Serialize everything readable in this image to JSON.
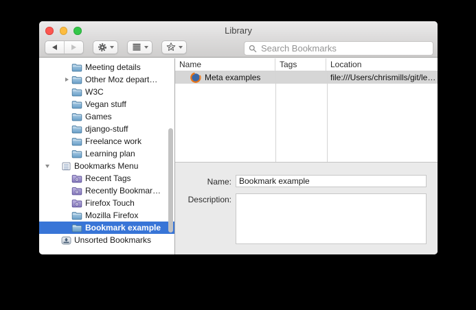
{
  "window": {
    "title": "Library"
  },
  "toolbar": {
    "search_placeholder": "Search Bookmarks",
    "buttons": [
      {
        "icon": "back-arrow-icon",
        "enabled": true
      },
      {
        "icon": "forward-arrow-icon",
        "enabled": false
      },
      {
        "icon": "gear-icon",
        "has_dropdown": true
      },
      {
        "icon": "list-view-icon",
        "has_dropdown": true
      },
      {
        "icon": "star-sync-icon",
        "has_dropdown": true
      }
    ]
  },
  "sidebar": {
    "items": [
      {
        "label": "Meeting details",
        "icon": "folder-icon",
        "indent": 2,
        "disclosure": "none",
        "selected": false
      },
      {
        "label": "Other Moz depart…",
        "icon": "folder-icon",
        "indent": 2,
        "disclosure": "collapsed",
        "selected": false
      },
      {
        "label": "W3C",
        "icon": "folder-icon",
        "indent": 2,
        "disclosure": "none",
        "selected": false
      },
      {
        "label": "Vegan stuff",
        "icon": "folder-icon",
        "indent": 2,
        "disclosure": "none",
        "selected": false
      },
      {
        "label": "Games",
        "icon": "folder-icon",
        "indent": 2,
        "disclosure": "none",
        "selected": false
      },
      {
        "label": "django-stuff",
        "icon": "folder-icon",
        "indent": 2,
        "disclosure": "none",
        "selected": false
      },
      {
        "label": "Freelance work",
        "icon": "folder-icon",
        "indent": 2,
        "disclosure": "none",
        "selected": false
      },
      {
        "label": "Learning plan",
        "icon": "folder-icon",
        "indent": 2,
        "disclosure": "none",
        "selected": false
      },
      {
        "label": "Bookmarks Menu",
        "icon": "bookmarks-menu-icon",
        "indent": 1,
        "disclosure": "expanded",
        "selected": false
      },
      {
        "label": "Recent Tags",
        "icon": "smart-folder-icon",
        "indent": 2,
        "disclosure": "none",
        "selected": false
      },
      {
        "label": "Recently Bookmar…",
        "icon": "smart-folder-icon",
        "indent": 2,
        "disclosure": "none",
        "selected": false
      },
      {
        "label": "Firefox Touch",
        "icon": "smart-folder-icon",
        "indent": 2,
        "disclosure": "none",
        "selected": false
      },
      {
        "label": "Mozilla Firefox",
        "icon": "folder-icon",
        "indent": 2,
        "disclosure": "none",
        "selected": false
      },
      {
        "label": "Bookmark example",
        "icon": "folder-icon",
        "indent": 2,
        "disclosure": "none",
        "selected": true
      },
      {
        "label": "Unsorted Bookmarks",
        "icon": "unsorted-tray-icon",
        "indent": 1,
        "disclosure": "none",
        "selected": false
      }
    ]
  },
  "list": {
    "columns": [
      "Name",
      "Tags",
      "Location"
    ],
    "rows": [
      {
        "name": "Meta examples",
        "icon": "firefox-icon",
        "tags": "",
        "location": "file:///Users/chrismills/git/le…",
        "selected": true
      }
    ]
  },
  "details": {
    "name_label": "Name:",
    "name_value": "Bookmark example",
    "description_label": "Description:",
    "description_value": ""
  },
  "colors": {
    "selection_blue": "#3875d7",
    "inactive_selection_gray": "#d6d6d6",
    "folder_blue": "#699fc8",
    "smart_folder_purple": "#8477bb",
    "window_chrome": "#dddcdc",
    "desktop_background": "#000000"
  }
}
